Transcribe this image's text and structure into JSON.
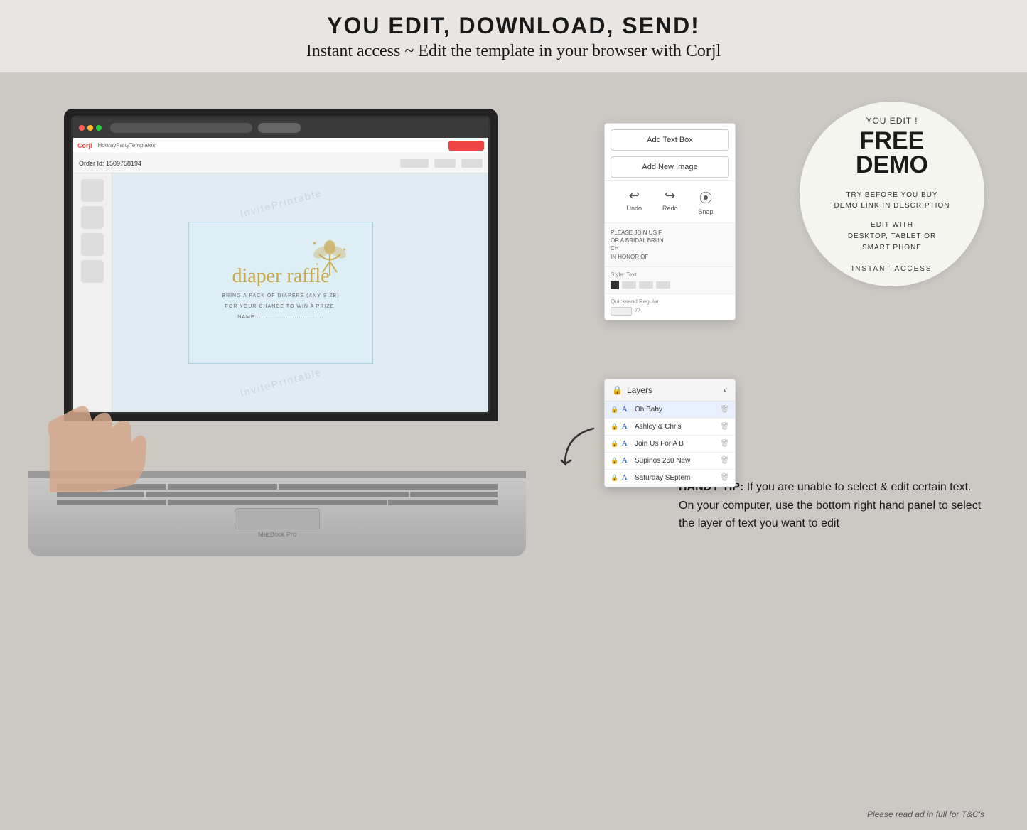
{
  "header": {
    "main_title": "YOU EDIT, DOWNLOAD, SEND!",
    "sub_title": "Instant access ~ Edit the template in your browser with Corjl"
  },
  "free_demo_circle": {
    "you_edit": "YOU EDIT !",
    "free": "FREE",
    "demo": "DEMO",
    "try_before": "TRY BEFORE YOU BUY",
    "demo_link": "DEMO LINK IN DESCRIPTION",
    "edit_with": "EDIT WITH",
    "devices": "DESKTOP, TABLET OR",
    "smart_phone": "SMART PHONE",
    "instant_access": "INSTANT ACCESS"
  },
  "corjl_panel": {
    "add_text_box": "Add Text Box",
    "add_new_image": "Add New Image",
    "undo_label": "Undo",
    "redo_label": "Redo",
    "snap_label": "Snap",
    "text_content": "PLEASE JOIN US F\nOR A BRIDAL BRUN\nCH\nIN HONOR OF",
    "style_text_label": "Style: Text"
  },
  "layers_panel": {
    "title": "Layers",
    "items": [
      {
        "lock": "🔒",
        "type": "A",
        "name": "Oh Baby",
        "selected": true
      },
      {
        "lock": "🔒",
        "type": "A",
        "name": "Ashley & Chris",
        "selected": false
      },
      {
        "lock": "🔒",
        "type": "A",
        "name": "Join Us For A B",
        "selected": false
      },
      {
        "lock": "🔒",
        "type": "A",
        "name": "Supinos 250 New",
        "selected": false
      },
      {
        "lock": "🔒",
        "type": "A",
        "name": "Saturday SEptem",
        "selected": false
      }
    ]
  },
  "diaper_raffle": {
    "title": "diaper raffle",
    "line1": "BRING A PACK OF DIAPERS (ANY SIZE)",
    "line2": "FOR YOUR CHANCE TO WIN A PRIZE.",
    "name_line": "NAME................................."
  },
  "handy_tip": {
    "bold_part": "HANDY TIP:",
    "text": " If you are unable to select & edit certain text. On your computer, use the bottom right hand panel to select the layer of text you want to edit"
  },
  "bottom_note": "Please read ad in full for T&C's",
  "watermark_text": "InvitePrintable",
  "icons": {
    "undo": "↩",
    "redo": "↪",
    "snap": "⦿",
    "lock": "🔒",
    "chevron": "∨",
    "trash": "🗑"
  }
}
